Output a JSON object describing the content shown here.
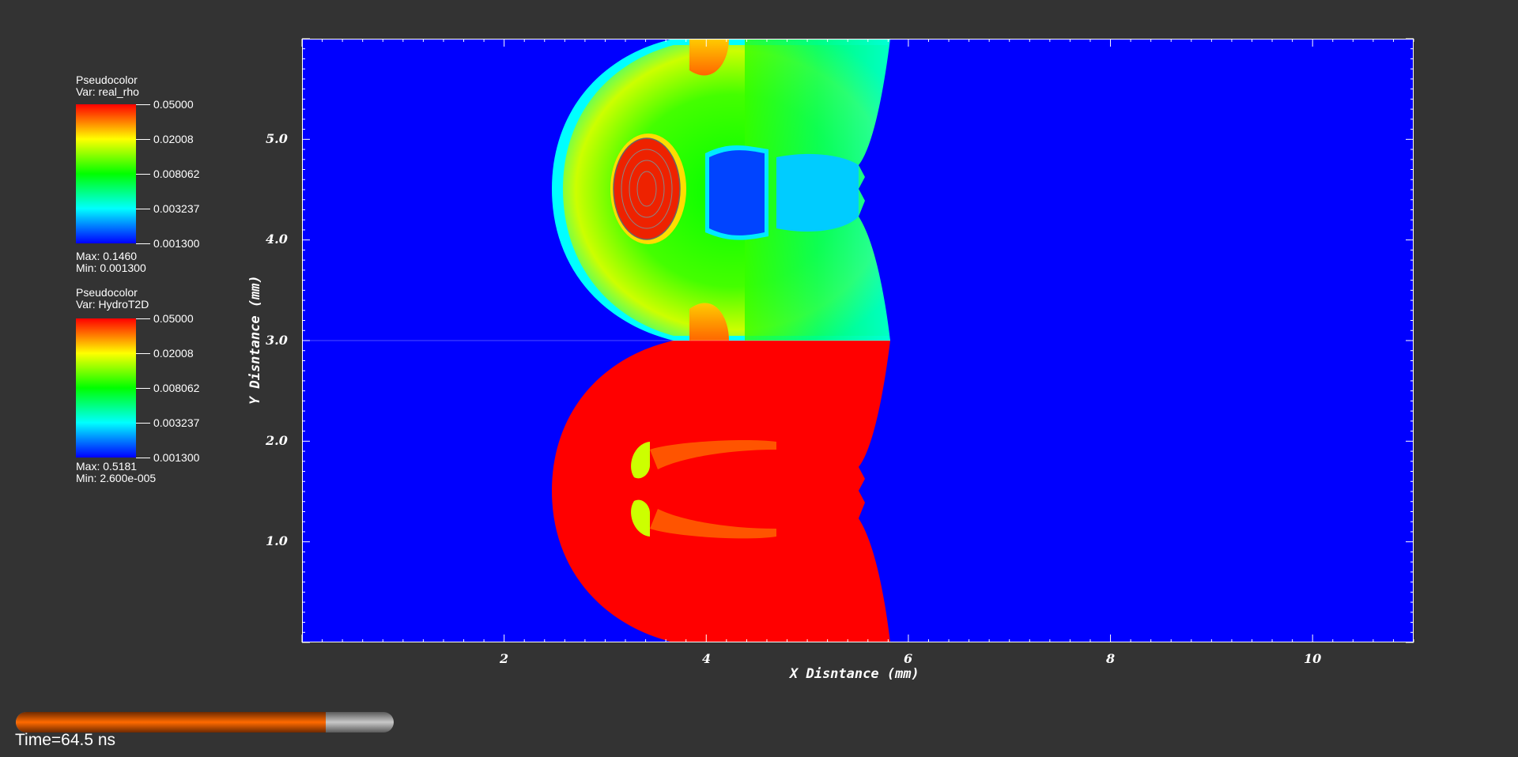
{
  "legends": [
    {
      "title": "Pseudocolor",
      "var": "Var: real_rho",
      "ticks": [
        "0.05000",
        "0.02008",
        "0.008062",
        "0.003237",
        "0.001300"
      ],
      "max": "Max:  0.1460",
      "min": "Min:  0.001300"
    },
    {
      "title": "Pseudocolor",
      "var": "Var: HydroT2D",
      "ticks": [
        "0.05000",
        "0.02008",
        "0.008062",
        "0.003237",
        "0.001300"
      ],
      "max": "Max:  0.5181",
      "min": "Min:  2.600e-005"
    }
  ],
  "colors": {
    "background": "#333333",
    "field_low": "#0000ff",
    "field_mid": "#00ff00",
    "field_high": "#ff0000",
    "progress": "#ff6a00"
  },
  "plot": {
    "xlabel": "X Disntance (mm)",
    "ylabel": "Y Disntance (mm)",
    "x_range": [
      0,
      11
    ],
    "y_range": [
      0,
      6
    ],
    "x_ticks": [
      "2",
      "4",
      "6",
      "8",
      "10"
    ],
    "y_ticks": [
      "1.0",
      "2.0",
      "3.0",
      "4.0",
      "5.0"
    ]
  },
  "time": {
    "label": "Time=64.5 ns",
    "progress_fraction": 0.82
  }
}
